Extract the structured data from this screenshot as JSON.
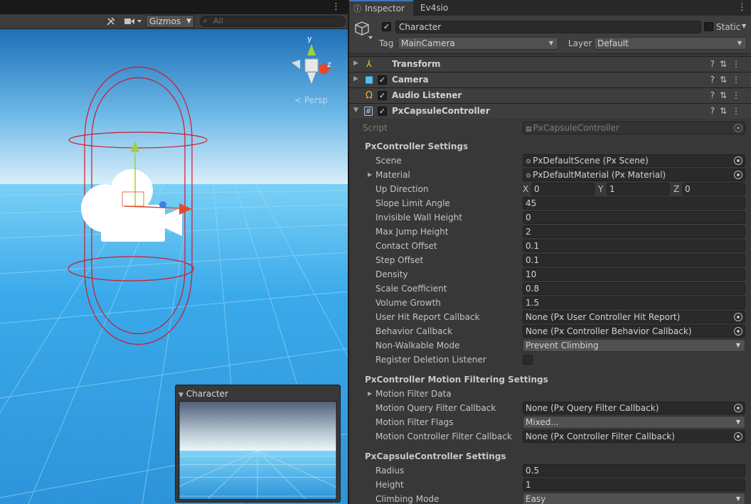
{
  "scene": {
    "gizmos_label": "Gizmos",
    "search_placeholder": "All",
    "axis_y": "y",
    "axis_z": "z",
    "persp_label": "Persp",
    "preview_title": "Character"
  },
  "tabs": [
    {
      "label": "Inspector",
      "icon": "info-icon"
    },
    {
      "label": "Ev4sio"
    }
  ],
  "header": {
    "object_name": "Character",
    "static_label": "Static",
    "tag_label": "Tag",
    "tag_value": "MainCamera",
    "layer_label": "Layer",
    "layer_value": "Default"
  },
  "components": [
    {
      "name": "Transform",
      "icon": "transform-icon"
    },
    {
      "name": "Camera",
      "icon": "camera-icon"
    },
    {
      "name": "Audio Listener",
      "icon": "headphones-icon"
    },
    {
      "name": "PxCapsuleController",
      "icon": "script-icon"
    }
  ],
  "script_row": {
    "label": "Script",
    "value": "PxCapsuleController"
  },
  "sections": {
    "controller": "PxController Settings",
    "motion": "PxController Motion Filtering Settings",
    "capsule": "PxCapsuleController Settings"
  },
  "props": {
    "scene": {
      "label": "Scene",
      "value": "PxDefaultScene (Px Scene)"
    },
    "material": {
      "label": "Material",
      "value": "PxDefaultMaterial (Px Material)"
    },
    "up_direction": {
      "label": "Up Direction",
      "x_label": "X",
      "x": "0",
      "y_label": "Y",
      "y": "1",
      "z_label": "Z",
      "z": "0"
    },
    "slope_limit": {
      "label": "Slope Limit Angle",
      "value": "45"
    },
    "invisible_wall": {
      "label": "Invisible Wall Height",
      "value": "0"
    },
    "max_jump": {
      "label": "Max Jump Height",
      "value": "2"
    },
    "contact_offset": {
      "label": "Contact Offset",
      "value": "0.1"
    },
    "step_offset": {
      "label": "Step Offset",
      "value": "0.1"
    },
    "density": {
      "label": "Density",
      "value": "10"
    },
    "scale_coeff": {
      "label": "Scale Coefficient",
      "value": "0.8"
    },
    "volume_growth": {
      "label": "Volume Growth",
      "value": "1.5"
    },
    "user_hit": {
      "label": "User Hit Report Callback",
      "value": "None (Px User Controller Hit Report)"
    },
    "behavior": {
      "label": "Behavior Callback",
      "value": "None (Px Controller Behavior Callback)"
    },
    "non_walkable": {
      "label": "Non-Walkable Mode",
      "value": "Prevent Climbing"
    },
    "register_deletion": {
      "label": "Register Deletion Listener"
    },
    "motion_filter_data": {
      "label": "Motion Filter Data"
    },
    "motion_query": {
      "label": "Motion Query Filter Callback",
      "value": "None (Px Query Filter Callback)"
    },
    "motion_flags": {
      "label": "Motion Filter Flags",
      "value": "Mixed..."
    },
    "motion_controller": {
      "label": "Motion Controller Filter Callback",
      "value": "None (Px Controller Filter Callback)"
    },
    "radius": {
      "label": "Radius",
      "value": "0.5"
    },
    "height": {
      "label": "Height",
      "value": "1"
    },
    "climbing_mode": {
      "label": "Climbing Mode",
      "value": "Easy"
    }
  },
  "colors": {
    "accent": "#3a79bb",
    "sky_top": "#2f9ee0",
    "ground": "#3aa9ea",
    "capsule_gizmo": "#d0192b"
  }
}
